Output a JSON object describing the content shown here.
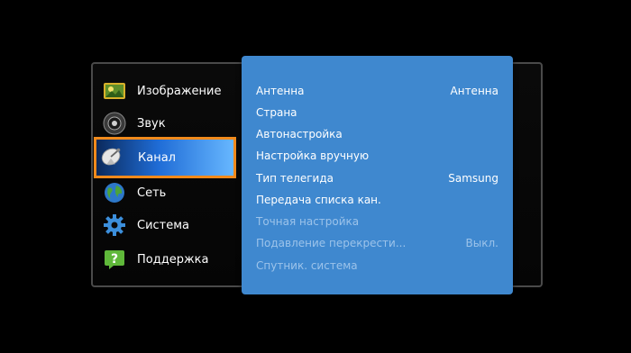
{
  "categories": [
    {
      "label": "Изображение",
      "icon": "picture-icon"
    },
    {
      "label": "Звук",
      "icon": "speaker-icon"
    },
    {
      "label": "Канал",
      "icon": "satellite-dish-icon"
    },
    {
      "label": "Сеть",
      "icon": "globe-icon"
    },
    {
      "label": "Система",
      "icon": "gear-icon"
    },
    {
      "label": "Поддержка",
      "icon": "help-icon"
    }
  ],
  "selected_category": "Канал",
  "channel_menu": [
    {
      "label": "Антенна",
      "value": "Антенна",
      "enabled": true
    },
    {
      "label": "Страна",
      "value": "",
      "enabled": true
    },
    {
      "label": "Автонастройка",
      "value": "",
      "enabled": true
    },
    {
      "label": "Настройка вручную",
      "value": "",
      "enabled": true
    },
    {
      "label": "Тип телегида",
      "value": "Samsung",
      "enabled": true
    },
    {
      "label": "Передача списка кан.",
      "value": "",
      "enabled": true
    },
    {
      "label": "Точная настройка",
      "value": "",
      "enabled": false
    },
    {
      "label": "Подавление перекрести...",
      "value": "Выкл.",
      "enabled": false
    },
    {
      "label": "Спутник. система",
      "value": "",
      "enabled": false
    }
  ],
  "colors": {
    "panel": "#3f88cf",
    "highlight_border": "#f08a1c",
    "disabled_text": "#9cc3ea"
  }
}
